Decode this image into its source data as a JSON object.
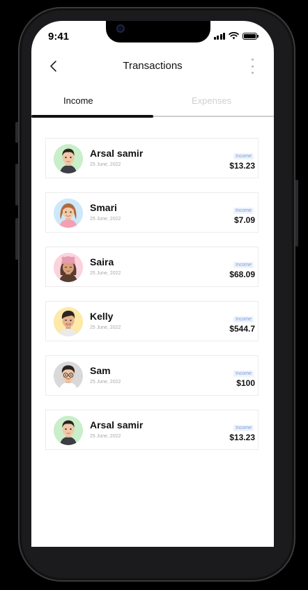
{
  "status_bar": {
    "time": "9:41"
  },
  "header": {
    "title": "Transactions"
  },
  "tabs": [
    {
      "label": "Income",
      "active": true
    },
    {
      "label": "Expenses",
      "active": false
    }
  ],
  "transactions": [
    {
      "name": "Arsal samir",
      "date": "25 June, 2022",
      "type": "Income",
      "amount": "$13.23",
      "avatar_bg": "#c9eec9"
    },
    {
      "name": "Smari",
      "date": "25 June, 2022",
      "type": "Income",
      "amount": "$7.09",
      "avatar_bg": "#cde8f8"
    },
    {
      "name": "Saira",
      "date": "25 June, 2022",
      "type": "Income",
      "amount": "$68.09",
      "avatar_bg": "#fbd3dc"
    },
    {
      "name": "Kelly",
      "date": "25 June, 2022",
      "type": "Income",
      "amount": "$544.7",
      "avatar_bg": "#fde9a8"
    },
    {
      "name": "Sam",
      "date": "25 June, 2022",
      "type": "Income",
      "amount": "$100",
      "avatar_bg": "#d9d9d9"
    },
    {
      "name": "Arsal samir",
      "date": "25 June, 2022",
      "type": "Income",
      "amount": "$13.23",
      "avatar_bg": "#c9eec9"
    }
  ],
  "icons": {
    "back": "back-arrow-icon",
    "menu": "more-vertical-icon",
    "signal": "cellular-signal-icon",
    "wifi": "wifi-icon",
    "battery": "battery-icon"
  }
}
